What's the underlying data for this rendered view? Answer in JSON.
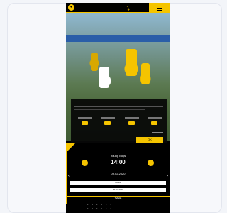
{
  "match": {
    "home_team": "Young Boys",
    "kickoff_time": "14:00",
    "date": "09.02.2020",
    "ticket_label": "Tickets",
    "date_button": "29.02.2020",
    "table_label": "Tabelle"
  },
  "cookie": {
    "ok_label": "OK"
  },
  "colors": {
    "brand_yellow": "#f5c400",
    "background": "#000000"
  }
}
